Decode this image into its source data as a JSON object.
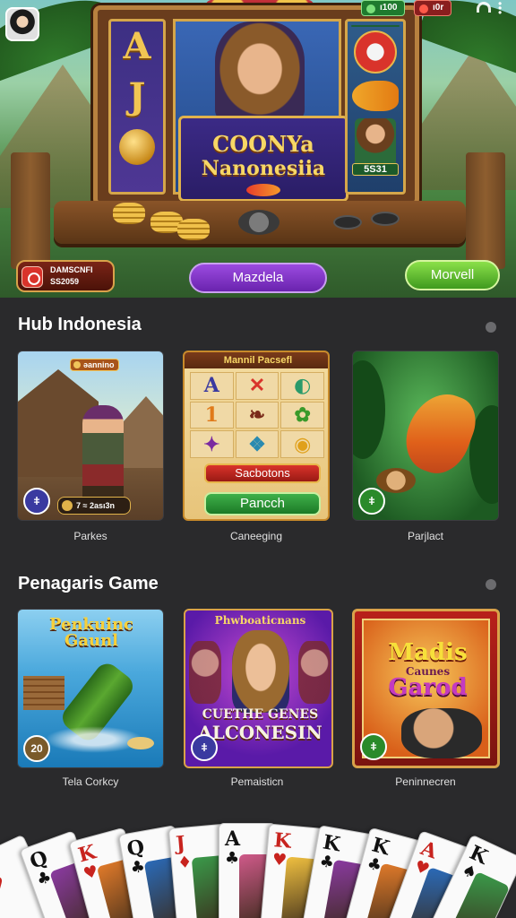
{
  "status_bar": {
    "stat_green": "ı100",
    "stat_red": "ı0r"
  },
  "hero": {
    "title_line1": "COONYa",
    "title_line2": "Nanonesiia",
    "reel_left_symbols": [
      "A",
      "J"
    ],
    "mini_value": "5S31",
    "balance_line1": "DAMSCNFI",
    "balance_line2": "SS2059",
    "center_button": "Mazdela",
    "right_button": "Morvell"
  },
  "sections": [
    {
      "title": "Hub Indonesia",
      "cards": [
        {
          "label": "Parkes",
          "tag": "ǝannino",
          "pill": "7  ≈ 2ası3n",
          "badge": "ǂ"
        },
        {
          "label": "Caneeging",
          "header": "Mannil Pacsefl",
          "cells": [
            "A",
            "✕",
            "◐",
            "1",
            "❧",
            "✿",
            "✦",
            "❖",
            "◉"
          ],
          "red_button": "Sacbotons",
          "green_button": "Pancch"
        },
        {
          "label": "Parjlact",
          "badge": "ǂ"
        }
      ]
    },
    {
      "title": "Penagaris Game",
      "cards": [
        {
          "label": "Tela Corkcy",
          "title": "Penkuinc Gaunl",
          "badge": "20"
        },
        {
          "label": "Pemaisticn",
          "header": "Phwboaticnans",
          "banner_line1": "CUETHE GENES",
          "banner_line2": "ALCONESIN",
          "badge": "ǂ"
        },
        {
          "label": "Peninnecren",
          "title1": "Madis",
          "title2": "Caunes",
          "title3": "Garod",
          "badge": "ǂ"
        }
      ]
    }
  ],
  "playing_cards": [
    {
      "rank": "A",
      "suit": "♥",
      "color": "#c8231e"
    },
    {
      "rank": "Q",
      "suit": "♣",
      "color": "#111111"
    },
    {
      "rank": "K",
      "suit": "♥",
      "color": "#c8231e"
    },
    {
      "rank": "Q",
      "suit": "♣",
      "color": "#111111"
    },
    {
      "rank": "J",
      "suit": "♦",
      "color": "#c8231e"
    },
    {
      "rank": "A",
      "suit": "♣",
      "color": "#111111"
    },
    {
      "rank": "K",
      "suit": "♥",
      "color": "#c8231e"
    },
    {
      "rank": "K",
      "suit": "♣",
      "color": "#111111"
    },
    {
      "rank": "K",
      "suit": "♣",
      "color": "#111111"
    },
    {
      "rank": "A",
      "suit": "♥",
      "color": "#c8231e"
    },
    {
      "rank": "K",
      "suit": "♠",
      "color": "#111111"
    }
  ],
  "colors": {
    "background": "#2a2a2c",
    "purple_button": "#7b33c8",
    "green_button": "#5cb82e"
  }
}
